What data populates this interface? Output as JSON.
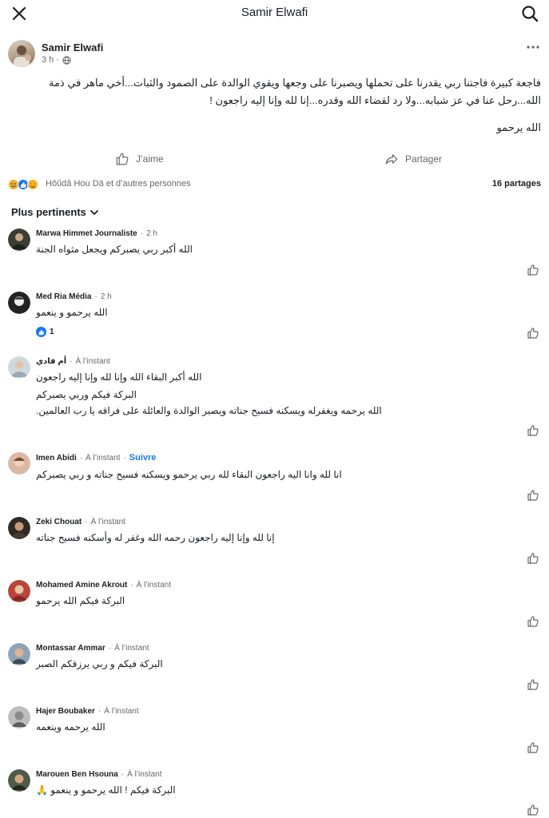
{
  "header": {
    "title": "Samir Elwafi",
    "close_icon": "close-icon",
    "search_icon": "search-icon"
  },
  "post": {
    "author": "Samir Elwafi",
    "time": "3 h ·",
    "text": "فاجعة كبيرة فاجتنا ربي يقدرنا على تحملها ويصبرنا على وجعها ويقوي الوالدة على الصمود والثبات...أخي ماهر في ذمة الله...رحل عنا في عز شبابه...ولا رد لقضاء الله وقدره...إنا لله وإنا إليه راجعون !",
    "text2": "الله يرحمو"
  },
  "actions": {
    "like": "J’aime",
    "share": "Partager"
  },
  "reactions": {
    "names": "Hôûdâ Hou Dä et d’autres personnes",
    "shares": "16 partages"
  },
  "sort_label": "Plus pertinents",
  "comments": [
    {
      "name": "Marwa Himmet Journaliste",
      "time": "2 h",
      "lines": [
        "الله أكبر ربي يصبركم ويجعل مثواه الجنة"
      ]
    },
    {
      "name": "Med Ria Média",
      "time": "2 h",
      "lines": [
        "الله يرحمو و ينعمو"
      ],
      "reaction_count": "1"
    },
    {
      "name": "أم فادي",
      "time": "À l’instant",
      "lines": [
        "الله أكبر البقاء الله وإنا لله وإنا إليه راجعون",
        "البركة فيكم وربي يصبركم",
        "الله يرحمه ويغفرله ويسكنه فسيح جناته ويصبر الوالدة والعائلة على فراقه يا رب العالمين."
      ]
    },
    {
      "name": "Imen Abidi",
      "time": "À l’instant",
      "follow": "Suivre",
      "lines": [
        "انا لله وانا اليه راجعون البقاء لله ربي يرحمو ويسكنه فسيح جناته و ربي يصبركم"
      ]
    },
    {
      "name": "Zeki Chouat",
      "time": "À l’instant",
      "lines": [
        "إنا لله وإنا إليه راجعون رحمه الله وغفر له وأسكنه فسيح جناته"
      ]
    },
    {
      "name": "Mohamed Amine Akrout",
      "time": "À l’instant",
      "lines": [
        "البركة فيكم الله يرحمو"
      ]
    },
    {
      "name": "Montassar Ammar",
      "time": "À l’instant",
      "lines": [
        "البركة فيكم و ربي يرزقكم الصبر"
      ]
    },
    {
      "name": "Hajer Boubaker",
      "time": "À l’instant",
      "lines": [
        "الله يرحمه وينعمه"
      ]
    },
    {
      "name": "Marouen Ben Hsouna",
      "time": "À l’instant",
      "lines": [
        "البركة فيكم ! الله يرحمو و ينعمو 🙏"
      ]
    }
  ],
  "colors": {
    "accent": "#1877f2",
    "muted": "#65676b",
    "text": "#1c1e21"
  }
}
